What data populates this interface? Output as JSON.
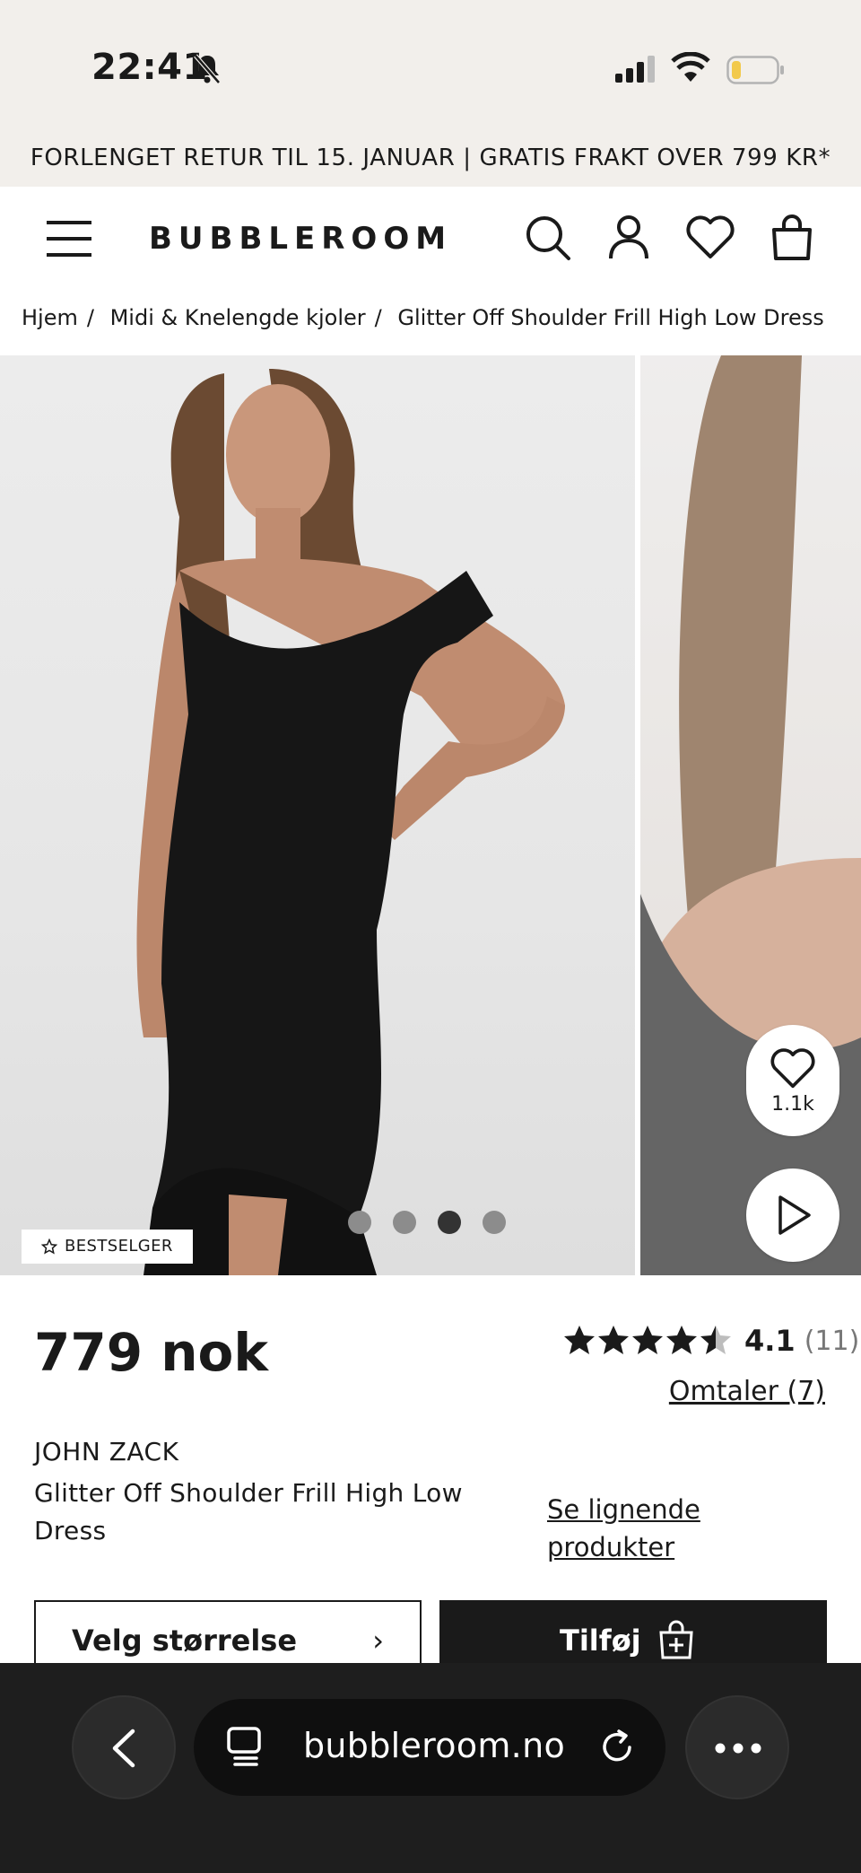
{
  "status_bar": {
    "time": "22:41"
  },
  "promo": {
    "text": "FORLENGET RETUR TIL 15. JANUAR | GRATIS FRAKT OVER 799 KR*"
  },
  "header": {
    "logo": "BUBBLEROOM"
  },
  "breadcrumbs": [
    {
      "label": "Hjem"
    },
    {
      "label": "Midi & Knelengde kjoler"
    },
    {
      "label": "Glitter Off Shoulder Frill High Low Dress"
    }
  ],
  "gallery": {
    "badge": "BESTSELGER",
    "like_count": "1.1k",
    "total_images": 4,
    "active_image": 3
  },
  "product": {
    "price": "779 nok",
    "rating": "4.1",
    "rating_count": "(11)",
    "stars_filled": 4.1,
    "reviews_link": "Omtaler (7)",
    "brand": "JOHN ZACK",
    "name": "Glitter Off Shoulder Frill High Low Dress",
    "similar_link": "Se lignende produkter",
    "size_button": "Velg størrelse",
    "add_button": "Tilføj"
  },
  "browser": {
    "url": "bubbleroom.no"
  },
  "colors": {
    "status_bg": "#f2efeb",
    "dark": "#1a1a1a",
    "browser_bg": "#1e1e1e"
  }
}
